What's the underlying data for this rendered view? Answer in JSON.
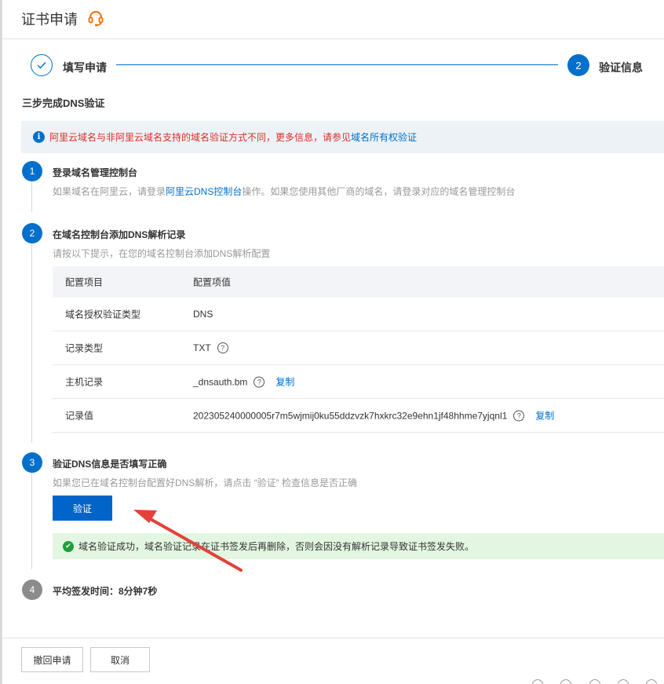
{
  "header": {
    "title": "证书申请"
  },
  "steps": [
    {
      "label": "填写申请",
      "state": "done"
    },
    {
      "number": "2",
      "label": "验证信息",
      "state": "active"
    }
  ],
  "section_title": "三步完成DNS验证",
  "info": {
    "text": "阿里云域名与非阿里云域名支持的域名验证方式不同，更多信息，请参见",
    "link": "域名所有权验证"
  },
  "step1": {
    "number": "1",
    "title": "登录域名管理控制台",
    "desc_pre": "如果域名在阿里云，请登录",
    "desc_link": "阿里云DNS控制台",
    "desc_post": "操作。如果您使用其他厂商的域名，请登录对应的域名管理控制台"
  },
  "step2": {
    "number": "2",
    "title": "在域名控制台添加DNS解析记录",
    "desc": "请按以下提示，在您的域名控制台添加DNS解析配置",
    "table": {
      "headers": [
        "配置项目",
        "配置项值"
      ],
      "rows": [
        {
          "key": "域名授权验证类型",
          "value": "DNS"
        },
        {
          "key": "记录类型",
          "value": "TXT"
        },
        {
          "key": "主机记录",
          "value": "_dnsauth.bm"
        },
        {
          "key": "记录值",
          "value": "202305240000005r7m5wjmij0ku55ddzvzk7hxkrc32e9ehn1jf48hhme7yjqnl1"
        }
      ],
      "copy_label": "复制"
    }
  },
  "step3": {
    "number": "3",
    "title": "验证DNS信息是否填写正确",
    "desc": "如果您已在域名控制台配置好DNS解析，请点击 “验证” 检查信息是否正确",
    "button": "验证",
    "success": "域名验证成功，域名验证记录在证书签发后再删除，否则会因没有解析记录导致证书签发失败。"
  },
  "step4": {
    "number": "4",
    "title": "平均签发时间：8分钟7秒"
  },
  "footer": {
    "revoke": "撤回申请",
    "cancel": "取消"
  },
  "colors": {
    "primary": "#0064c8",
    "error": "#d93026",
    "success": "#1e9f3a",
    "annotation_arrow": "#e5413b"
  }
}
